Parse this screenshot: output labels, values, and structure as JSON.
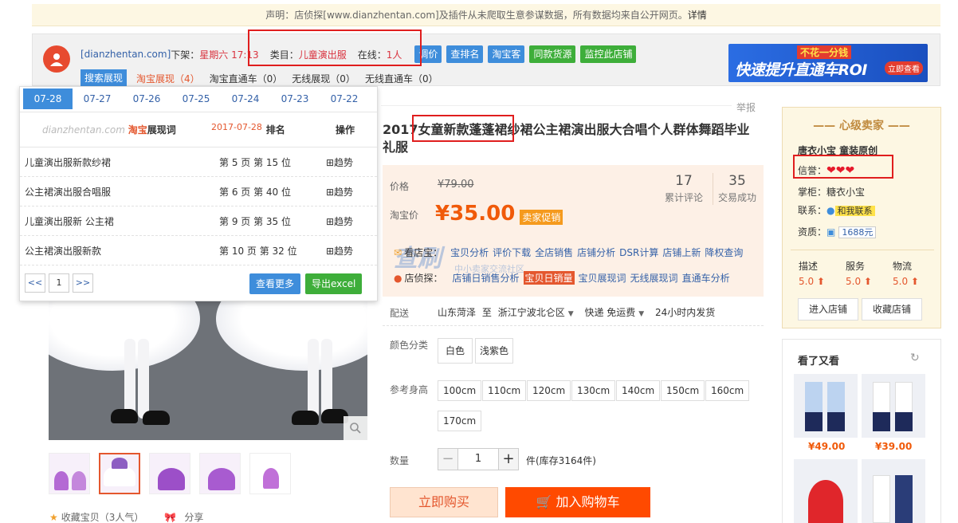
{
  "notice": {
    "text": "声明：店侦探[www.dianzhentan.com]及插件从未爬取生意参谋数据，所有数据均来自公开网页。",
    "link": "详情"
  },
  "plugin": {
    "domain": "[dianzhentan.com]",
    "offshelf_label": "下架：",
    "offshelf_value": "星期六 17:13",
    "category_label": "类目：",
    "category_value": "儿童演出服",
    "online_label": "在线：",
    "online_value": "1人",
    "buttons": [
      "调价",
      "查排名",
      "淘宝客",
      "同款货源",
      "监控此店铺"
    ],
    "tabs": [
      "搜索展现",
      "淘宝展现（4）",
      "淘宝直通车（0）",
      "无线展现（0）",
      "无线直通车（0）"
    ]
  },
  "ad": {
    "tag": "不花一分钱",
    "headline": "快速提升直通车ROI",
    "cta": "立即查看"
  },
  "trend_panel": {
    "dates": [
      "07-28",
      "07-27",
      "07-26",
      "07-25",
      "07-24",
      "07-23",
      "07-22"
    ],
    "brand": "dianzhentan.com",
    "brand_taobao": "淘宝",
    "brand_suffix": "展现词",
    "date": "2017-07-28",
    "col_rank": "排名",
    "col_op": "操作",
    "rows": [
      {
        "keyword": "儿童演出服新款纱裙",
        "position": "第 5 页 第 15 位",
        "trend": "⊞趋势"
      },
      {
        "keyword": "公主裙演出服合唱服",
        "position": "第 6 页 第 40 位",
        "trend": "⊞趋势"
      },
      {
        "keyword": "儿童演出服新 公主裙",
        "position": "第 9 页 第 35 位",
        "trend": "⊞趋势"
      },
      {
        "keyword": "公主裙演出服新款",
        "position": "第 10 页 第 32 位",
        "trend": "⊞趋势"
      }
    ],
    "prev": "<<",
    "page": "1",
    "next": ">>",
    "more_btn": "查看更多",
    "export_btn": "导出excel"
  },
  "product": {
    "report": "举报",
    "title": "2017女童新款蓬蓬裙纱裙公主裙演出服大合唱个人群体舞蹈毕业礼服",
    "price_label": "价格",
    "orig_price": "¥79.00",
    "reviews_num": "17",
    "reviews_label": "累计评论",
    "sales_num": "35",
    "sales_label": "交易成功",
    "tb_price_label": "淘宝价",
    "tb_price": "¥35.00",
    "promo": "卖家促销",
    "watermark": "查刷",
    "watermark_sub": "中小卖家交流社区",
    "look_label": "看店宝：",
    "look_links": [
      "宝贝分析",
      "评价下载",
      "全店销售",
      "店铺分析",
      "DSR计算",
      "店铺上新",
      "降权查询"
    ],
    "detect_label": "店侦探：",
    "detect_links": [
      "店铺日销售分析",
      "宝贝日销量",
      "宝贝展现词",
      "无线展现词",
      "直通车分析"
    ],
    "ship_label": "配送",
    "ship_from": "山东菏泽",
    "ship_to_word": "至",
    "ship_to": "浙江宁波北仑区",
    "ship_method": "快递 免运费",
    "ship_time": "24小时内发货",
    "color_label": "颜色分类",
    "colors": [
      "白色",
      "浅紫色"
    ],
    "height_label": "参考身高",
    "heights": [
      "100cm",
      "110cm",
      "120cm",
      "130cm",
      "140cm",
      "150cm",
      "160cm",
      "170cm"
    ],
    "qty_label": "数量",
    "qty_minus": "−",
    "qty_value": "1",
    "qty_plus": "+",
    "stock": "件(库存3164件)",
    "buy_btn": "立即购买",
    "cart_btn": "加入购物车",
    "fav": "收藏宝贝（3人气）",
    "share": "分享"
  },
  "seller": {
    "head": "心级卖家",
    "shop": "唐衣小宝 童装原创",
    "credit_label": "信誉：",
    "hearts": "❤❤❤",
    "keeper_label": "掌柜：",
    "keeper": "糖衣小宝",
    "contact_label": "联系：",
    "contact": "和我联系",
    "qual_label": "资质：",
    "qual": "1688元",
    "scores": [
      {
        "label": "描述",
        "value": "5.0 ⬆"
      },
      {
        "label": "服务",
        "value": "5.0 ⬆"
      },
      {
        "label": "物流",
        "value": "5.0 ⬆"
      }
    ],
    "enter_btn": "进入店铺",
    "collect_btn": "收藏店铺"
  },
  "also": {
    "title": "看了又看",
    "prices": [
      "¥49.00",
      "¥39.00"
    ]
  },
  "colors": {
    "accent_blue": "#3e8ddb",
    "accent_green": "#3eae3a",
    "price_orange": "#f05a0a",
    "highlight_red": "#e01e1e"
  }
}
